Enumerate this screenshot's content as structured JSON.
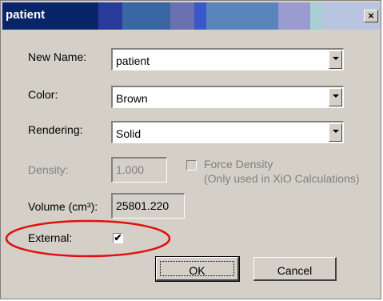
{
  "window": {
    "title": "patient",
    "close_glyph": "×"
  },
  "form": {
    "new_name": {
      "label": "New Name:",
      "value": "patient"
    },
    "color": {
      "label": "Color:",
      "value": "Brown"
    },
    "rendering": {
      "label": "Rendering:",
      "value": "Solid"
    },
    "density": {
      "label": "Density:",
      "value": "1.000"
    },
    "force_density": {
      "label_line1": "Force Density",
      "label_line2": "(Only used in XiO Calculations)",
      "checked": false
    },
    "volume": {
      "label": "Volume (cm³):",
      "value": "25801.220"
    },
    "external": {
      "label": "External:",
      "checked": true,
      "check_glyph": "✔"
    }
  },
  "buttons": {
    "ok": "OK",
    "cancel": "Cancel"
  },
  "annotation": {
    "type": "red-ellipse-highlight",
    "color": "#e01010"
  }
}
